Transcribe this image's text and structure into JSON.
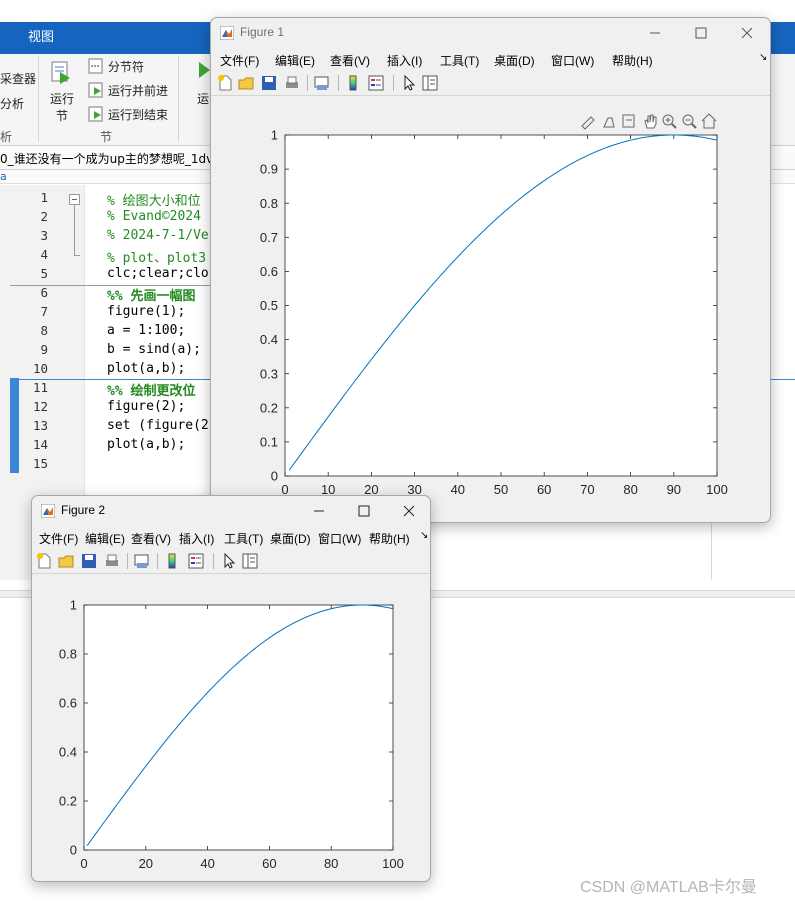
{
  "matlab": {
    "ribbon_tab": "视图",
    "ribbon": {
      "left_items": [
        "采查器",
        "分析"
      ],
      "left_section": "析",
      "run_section": {
        "run_section_label": "运行\n节",
        "run_section_label_line1": "运行",
        "run_section_label_line2": "节",
        "section_break": "分节符",
        "run_and_advance": "运行并前进",
        "run_to_end": "运行到结束",
        "group_label": "节"
      },
      "run_label": "运"
    },
    "file_tab": "0_谁还没有一个成为up主的梦想呢_1dv",
    "editor": {
      "line_numbers": [
        "1",
        "2",
        "3",
        "4",
        "5",
        "6",
        "7",
        "8",
        "9",
        "10",
        "11",
        "12",
        "13",
        "14",
        "15"
      ],
      "lines": [
        {
          "text": "% 绘图大小和位",
          "kind": "cm"
        },
        {
          "text": "% Evand©2024",
          "kind": "cm"
        },
        {
          "text": "% 2024-7-1/Ve",
          "kind": "cm"
        },
        {
          "text": "% plot、plot3",
          "kind": "cm"
        },
        {
          "text": "clc;clear;clo",
          "kind": "code"
        },
        {
          "text": "%% 先画一幅图",
          "kind": "sec"
        },
        {
          "text": "figure(1);",
          "kind": "code"
        },
        {
          "text": "a = 1:100;",
          "kind": "code"
        },
        {
          "text": "b = sind(a);",
          "kind": "code"
        },
        {
          "text": "plot(a,b);",
          "kind": "code"
        },
        {
          "text": "%% 绘制更改位",
          "kind": "sec"
        },
        {
          "text": "figure(2);",
          "kind": "code"
        },
        {
          "text": "set (figure(2",
          "kind": "code"
        },
        {
          "text": "plot(a,b);",
          "kind": "code"
        },
        {
          "text": "",
          "kind": "code"
        }
      ]
    }
  },
  "figures": [
    {
      "title": "Figure 1",
      "title_color": "#6f6f6f",
      "menus": [
        "文件(F)",
        "编辑(E)",
        "查看(V)",
        "插入(I)",
        "工具(T)",
        "桌面(D)",
        "窗口(W)",
        "帮助(H)"
      ],
      "toolbar_icons": [
        "new-file-icon",
        "open-folder-icon",
        "save-icon",
        "print-icon",
        "print-preview-icon",
        "colorbar-icon",
        "legend-icon",
        "pointer-icon",
        "property-inspector-icon"
      ],
      "axes_toolbar_icons": [
        "export-icon",
        "brush-icon",
        "data-tips-icon",
        "pan-icon",
        "zoom-in-icon",
        "zoom-out-icon",
        "home-icon"
      ],
      "chart_data": {
        "type": "line",
        "title": "",
        "xlabel": "",
        "ylabel": "",
        "xlim": [
          0,
          100
        ],
        "ylim": [
          0,
          1
        ],
        "xticks": [
          "0",
          "10",
          "20",
          "30",
          "40",
          "50",
          "60",
          "70",
          "80",
          "90",
          "100"
        ],
        "yticks": [
          "0",
          "0.1",
          "0.2",
          "0.3",
          "0.4",
          "0.5",
          "0.6",
          "0.7",
          "0.8",
          "0.9",
          "1"
        ],
        "series": [
          {
            "expression": "b = sind(a)",
            "x_start": 1,
            "x_end": 100,
            "x_step": 1,
            "color": "#0072bd"
          }
        ],
        "grid": false
      }
    },
    {
      "title": "Figure 2",
      "title_color": "#000000",
      "menus": [
        "文件(F)",
        "编辑(E)",
        "查看(V)",
        "插入(I)",
        "工具(T)",
        "桌面(D)",
        "窗口(W)",
        "帮助(H)"
      ],
      "toolbar_icons": [
        "new-file-icon",
        "open-folder-icon",
        "save-icon",
        "print-icon",
        "print-preview-icon",
        "colorbar-icon",
        "legend-icon",
        "pointer-icon",
        "property-inspector-icon"
      ],
      "chart_data": {
        "type": "line",
        "title": "",
        "xlabel": "",
        "ylabel": "",
        "xlim": [
          0,
          100
        ],
        "ylim": [
          0,
          1
        ],
        "xticks": [
          "0",
          "20",
          "40",
          "60",
          "80",
          "100"
        ],
        "yticks": [
          "0",
          "0.2",
          "0.4",
          "0.6",
          "0.8",
          "1"
        ],
        "series": [
          {
            "expression": "b = sind(a)",
            "x_start": 1,
            "x_end": 100,
            "x_step": 1,
            "color": "#0072bd"
          }
        ],
        "grid": false
      }
    }
  ],
  "watermark": "CSDN @MATLAB卡尔曼"
}
